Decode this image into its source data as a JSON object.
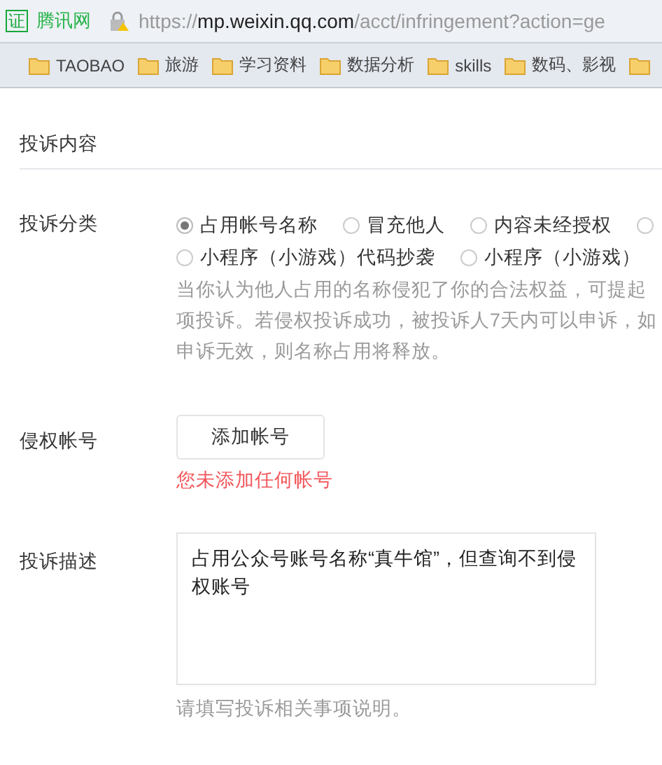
{
  "browser": {
    "site_badge": "证",
    "site_name": "腾讯网",
    "url_scheme": "https://",
    "url_domain": "mp.weixin.qq.com",
    "url_path": "/acct/infringement?action=ge"
  },
  "bookmarks": [
    {
      "label": "TAOBAO"
    },
    {
      "label": "旅游"
    },
    {
      "label": "学习资料"
    },
    {
      "label": "数据分析"
    },
    {
      "label": "skills"
    },
    {
      "label": "数码、影视"
    }
  ],
  "section_title": "投诉内容",
  "category": {
    "label": "投诉分类",
    "option_rows": [
      [
        {
          "label": "占用帐号名称",
          "selected": true
        },
        {
          "label": "冒充他人",
          "selected": false
        },
        {
          "label": "内容未经授权",
          "selected": false
        },
        {
          "selected": false
        }
      ],
      [
        {
          "label": "小程序（小游戏）代码抄袭",
          "selected": false
        },
        {
          "label": "小程序（小游戏）",
          "selected": false
        }
      ]
    ],
    "help_lines": [
      "当你认为他人占用的名称侵犯了你的合法权益，可提起",
      "项投诉。若侵权投诉成功，被投诉人7天内可以申诉，如",
      "申诉无效，则名称占用将释放。"
    ]
  },
  "account": {
    "label": "侵权帐号",
    "button": "添加帐号",
    "error": "您未添加任何帐号"
  },
  "description": {
    "label": "投诉描述",
    "value": "占用公众号账号名称“真牛馆”，但查询不到侵权账号",
    "hint": "请填写投诉相关事项说明。"
  }
}
